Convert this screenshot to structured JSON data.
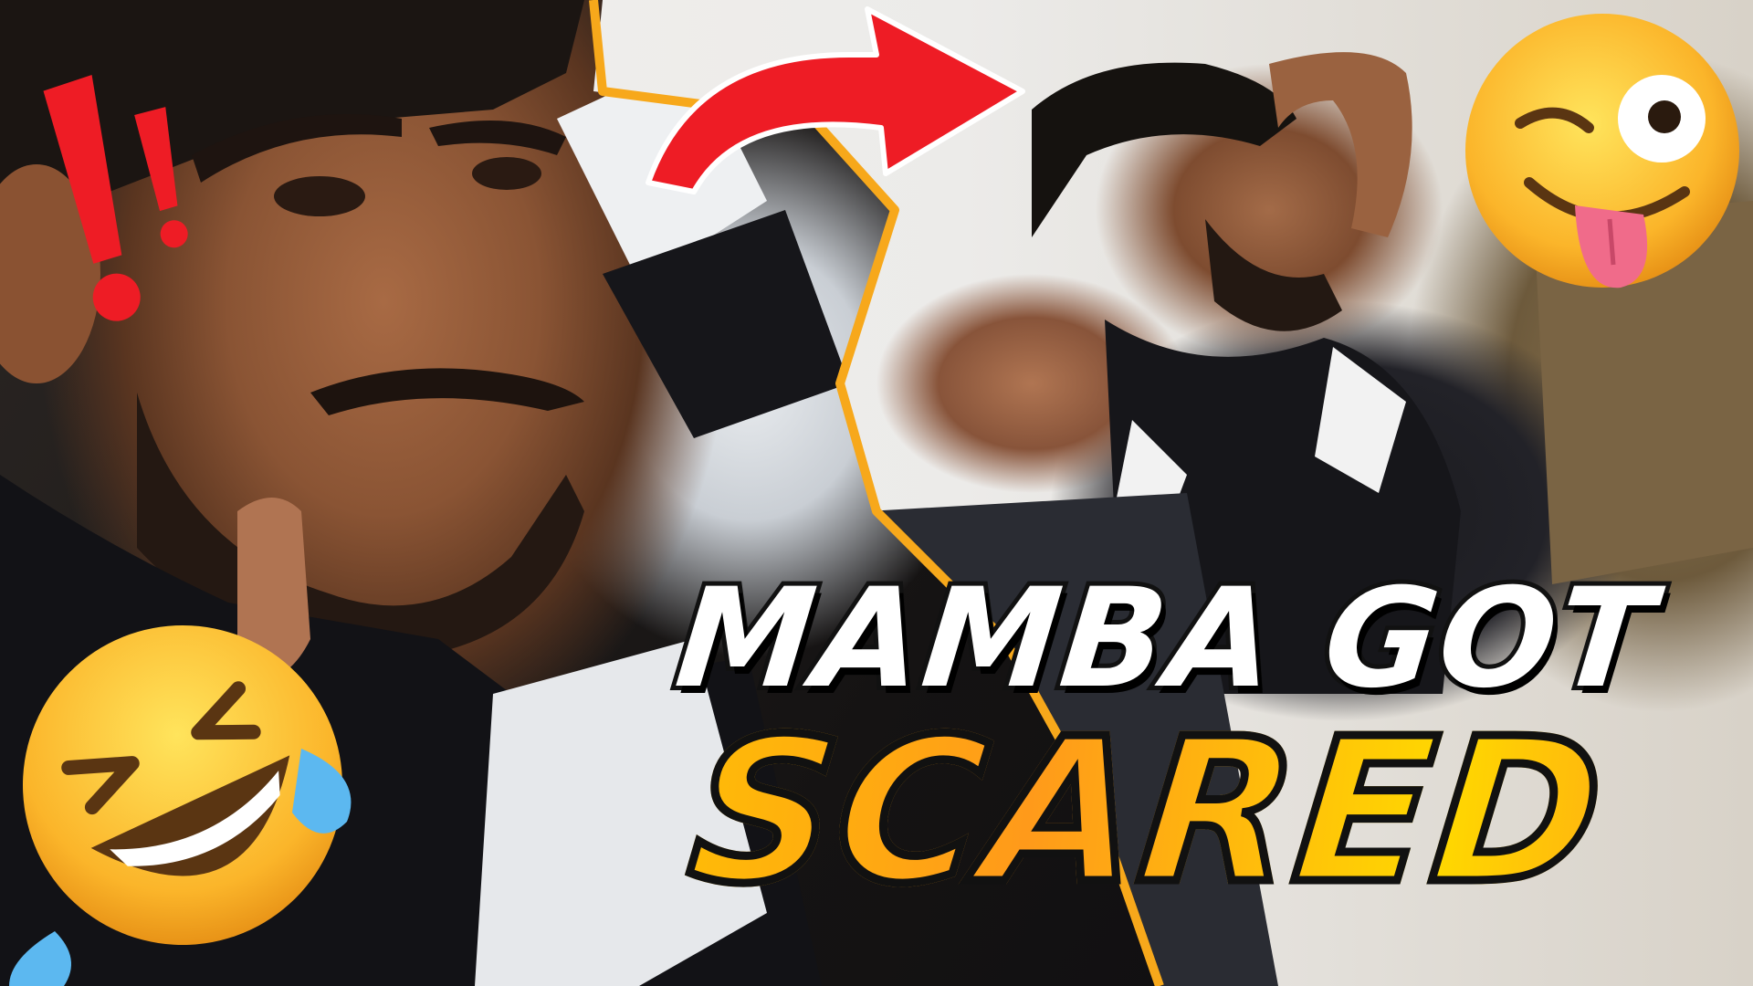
{
  "thumbnail": {
    "headline_line1": "MAMBA GOT",
    "headline_line2": "SCARED",
    "colors": {
      "headline_top": "#ffffff",
      "headline_bottom_start": "#ffc800",
      "headline_bottom_end": "#ff9a1a",
      "outline": "#111111",
      "arrow": "#ee1c25",
      "panel_border": "#f7a81b"
    },
    "icons": {
      "arrow": "curved-arrow-icon",
      "exclamation": "double-exclamation-icon",
      "emoji_top_right": "winking-tongue-emoji",
      "emoji_bottom_left": "rolling-laughing-emoji"
    }
  }
}
